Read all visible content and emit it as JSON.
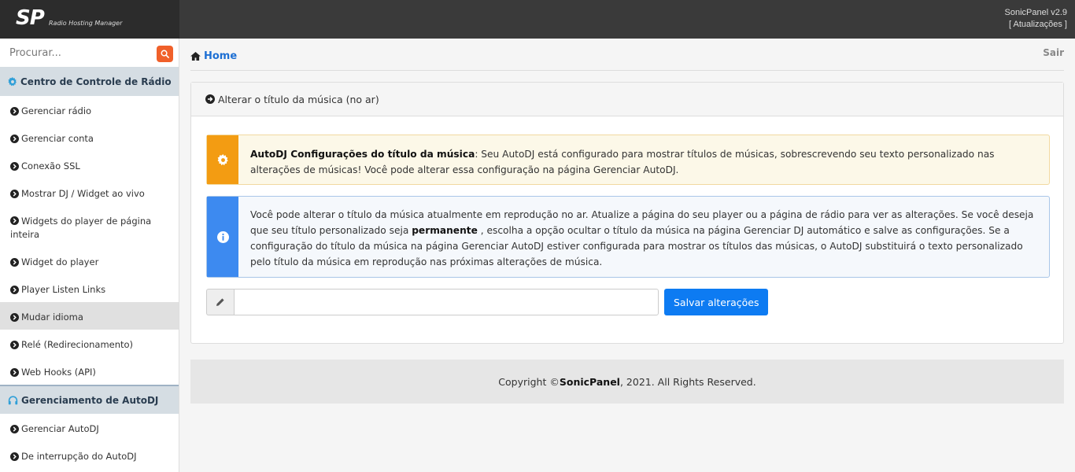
{
  "topbar": {
    "logo_mark": "SP",
    "logo_subtitle": "Radio Hosting Manager",
    "version": "SonicPanel v2.9",
    "updates_link": "[ Atualizações ]"
  },
  "sidebar": {
    "search_placeholder": "Procurar...",
    "sections": [
      {
        "title": "Centro de Controle de Rádio",
        "icon": "gear-icon",
        "items": [
          {
            "label": "Gerenciar rádio"
          },
          {
            "label": "Gerenciar conta"
          },
          {
            "label": "Conexão SSL"
          },
          {
            "label": "Mostrar DJ / Widget ao vivo"
          },
          {
            "label": "Widgets do player de página inteira"
          },
          {
            "label": "Widget do player"
          },
          {
            "label": "Player Listen Links"
          },
          {
            "label": "Mudar idioma",
            "active": true
          },
          {
            "label": "Relé (Redirecionamento)"
          },
          {
            "label": "Web Hooks (API)"
          }
        ]
      },
      {
        "title": "Gerenciamento de AutoDJ",
        "icon": "headphones-icon",
        "items": [
          {
            "label": "Gerenciar AutoDJ"
          },
          {
            "label": "De interrupção do AutoDJ"
          }
        ]
      }
    ]
  },
  "breadcrumb": {
    "home": "Home",
    "logout": "Sair"
  },
  "panel": {
    "title": "Alterar o título da música (no ar)",
    "warning": {
      "bold": "AutoDJ Configurações do título da música",
      "text": ": Seu AutoDJ está configurado para mostrar títulos de músicas, sobrescrevendo seu texto personalizado nas alterações de músicas! Você pode alterar essa configuração na página Gerenciar AutoDJ."
    },
    "info": {
      "text_before": "Você pode alterar o título da música atualmente em reprodução no ar. Atualize a página do seu player ou a página de rádio para ver as alterações. Se você deseja que seu título personalizado seja ",
      "bold": "permanente",
      "text_after": " , escolha a opção ocultar o título da música na página Gerenciar DJ automático e salve as configurações. Se a configuração do título da música na página Gerenciar AutoDJ estiver configurada para mostrar os títulos das músicas, o AutoDJ substituirá o texto personalizado pelo título da música em reprodução nas próximas alterações de música."
    },
    "input_value": "",
    "save_label": "Salvar alterações"
  },
  "footer": {
    "prefix": "Copyright © ",
    "brand": "SonicPanel",
    "suffix": ", 2021. All Rights Reserved."
  },
  "colors": {
    "accent": "#0d7bf2",
    "warning": "#f39c12",
    "info": "#3d8af0",
    "search_button": "#f0602a"
  }
}
